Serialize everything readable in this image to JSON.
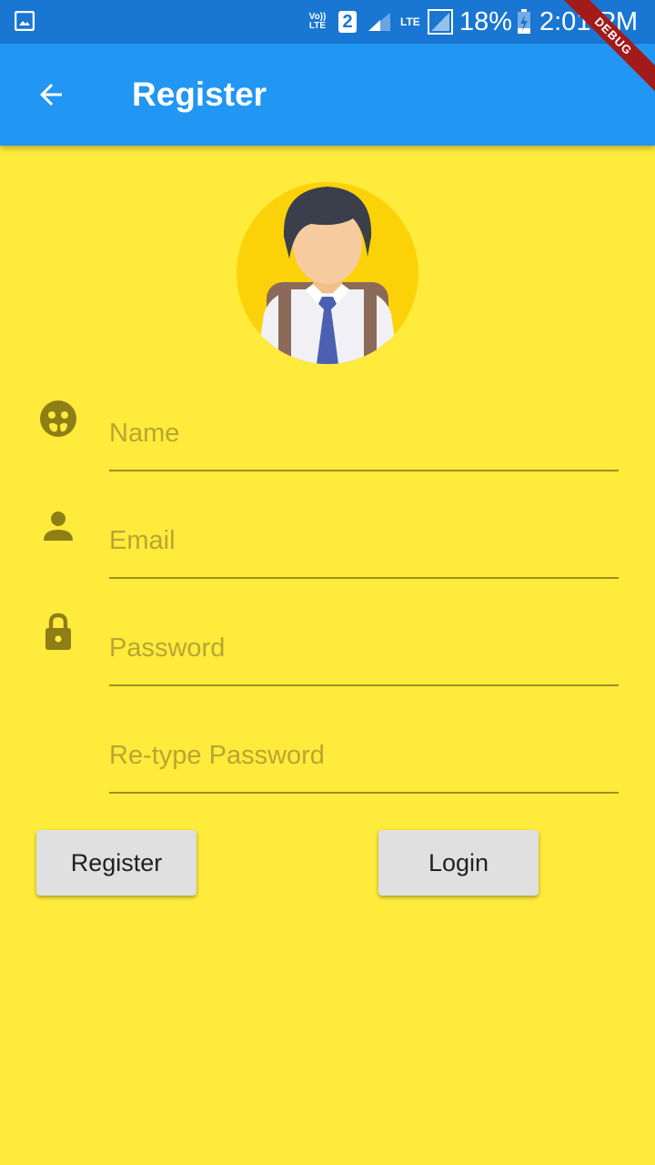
{
  "status_bar": {
    "volte_top": "Vo))",
    "volte_bottom": "LTE",
    "sim_number": "2",
    "lte_label": "LTE",
    "battery_percent": "18%",
    "time": "2:01 PM"
  },
  "debug_banner": "DEBUG",
  "app_bar": {
    "title": "Register",
    "back_icon": "arrow-back-icon",
    "background_color": "#2196f3"
  },
  "form": {
    "name_placeholder": "Name",
    "email_placeholder": "Email",
    "password_placeholder": "Password",
    "retype_password_placeholder": "Re-type Password"
  },
  "buttons": {
    "register_label": "Register",
    "login_label": "Login"
  },
  "colors": {
    "background": "#ffeb3b",
    "status_bar": "#1976d2",
    "icon": "#8d7e16",
    "underline": "#9e8f1e"
  }
}
